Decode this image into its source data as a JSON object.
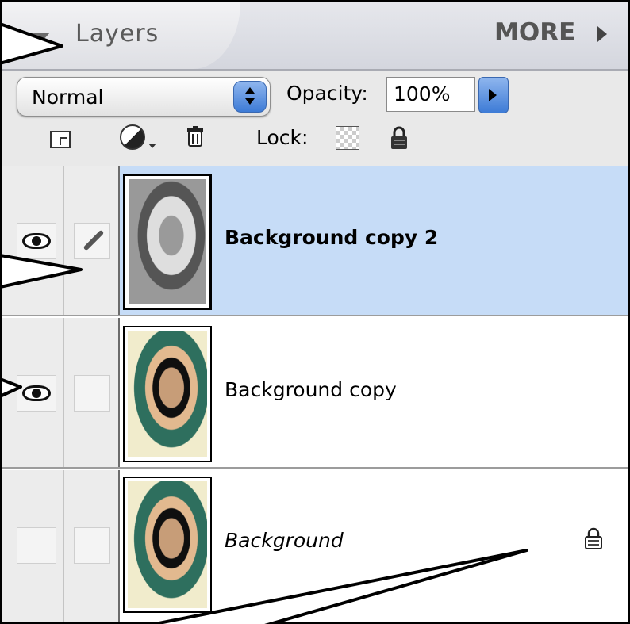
{
  "panel": {
    "title": "Layers",
    "more_label": "MORE"
  },
  "controls": {
    "blend_mode": "Normal",
    "opacity_label": "Opacity:",
    "opacity_value": "100%",
    "lock_label": "Lock:"
  },
  "icons": {
    "collapse": "collapse-triangle-icon",
    "more": "menu-arrow-icon",
    "new_layer": "new-layer-icon",
    "adjustment": "adjustment-layer-icon",
    "trash": "trash-icon",
    "lock_transparent": "lock-transparent-icon",
    "lock_all": "lock-icon",
    "visibility": "eye-icon",
    "link": "brush-icon"
  },
  "layers": [
    {
      "name": "Background copy 2",
      "visible": true,
      "linked": true,
      "selected": true,
      "locked": false
    },
    {
      "name": "Background copy",
      "visible": true,
      "linked": false,
      "selected": false,
      "locked": false
    },
    {
      "name": "Background",
      "visible": false,
      "linked": false,
      "selected": false,
      "locked": true
    }
  ],
  "colors": {
    "selected_row": "#c6dcf7",
    "accent_blue": "#3d7bd6"
  }
}
